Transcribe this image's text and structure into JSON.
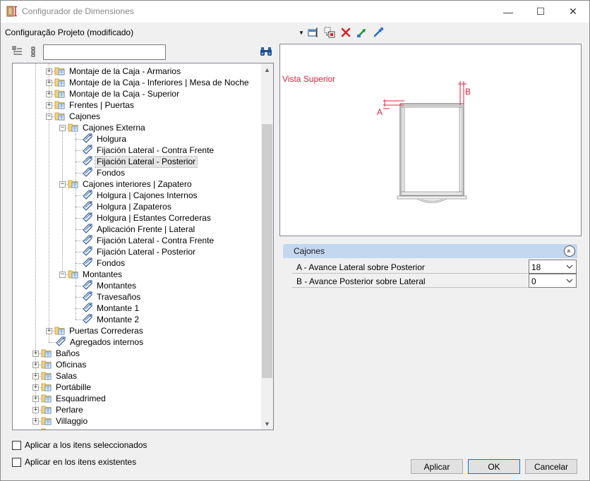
{
  "window": {
    "title": "Configurador de Dimensiones",
    "minimize_glyph": "—",
    "maximize_glyph": "☐",
    "close_glyph": "✕"
  },
  "config": {
    "label": "Configuração Projeto (modificado)",
    "dropdown_glyph": "▼"
  },
  "toolbar_icons": [
    "select-view-icon",
    "copy-config-icon",
    "delete-icon",
    "import-icon",
    "export-icon"
  ],
  "tree_search": {
    "value": "",
    "placeholder": ""
  },
  "tree": [
    {
      "label": "Montaje de la Caja - Armarios",
      "kind": "folder",
      "expander": "+"
    },
    {
      "label": "Montaje de la Caja - Inferiores | Mesa de Noche",
      "kind": "folder",
      "expander": "+"
    },
    {
      "label": "Montaje de la Caja - Superior",
      "kind": "folder",
      "expander": "+"
    },
    {
      "label": "Frentes | Puertas",
      "kind": "folder",
      "expander": "+"
    },
    {
      "label": "Cajones",
      "kind": "folder",
      "expander": "−"
    },
    {
      "label": "Cajones Externa",
      "kind": "folder",
      "expander": "−"
    },
    {
      "label": "Holgura",
      "kind": "leaf"
    },
    {
      "label": "Fijación Lateral - Contra Frente",
      "kind": "leaf"
    },
    {
      "label": "Fijación Lateral - Posterior",
      "kind": "leaf",
      "selected": true
    },
    {
      "label": "Fondos",
      "kind": "leaf"
    },
    {
      "label": "Cajones interiores | Zapatero",
      "kind": "folder",
      "expander": "−"
    },
    {
      "label": "Holgura | Cajones Internos",
      "kind": "leaf"
    },
    {
      "label": "Holgura | Zapateros",
      "kind": "leaf"
    },
    {
      "label": "Holgura | Estantes Correderas",
      "kind": "leaf"
    },
    {
      "label": "Aplicación Frente | Lateral",
      "kind": "leaf"
    },
    {
      "label": "Fijación Lateral - Contra Frente",
      "kind": "leaf"
    },
    {
      "label": "Fijación Lateral - Posterior",
      "kind": "leaf"
    },
    {
      "label": "Fondos",
      "kind": "leaf"
    },
    {
      "label": "Montantes",
      "kind": "folder",
      "expander": "−"
    },
    {
      "label": "Montantes",
      "kind": "leaf"
    },
    {
      "label": "Travesaños",
      "kind": "leaf"
    },
    {
      "label": "Montante 1",
      "kind": "leaf"
    },
    {
      "label": "Montante 2",
      "kind": "leaf"
    },
    {
      "label": "Puertas Correderas",
      "kind": "folder",
      "expander": "+"
    },
    {
      "label": "Agregados internos",
      "kind": "leaf"
    },
    {
      "label": "Baños",
      "kind": "folder",
      "expander": "+"
    },
    {
      "label": "Oficinas",
      "kind": "folder",
      "expander": "+"
    },
    {
      "label": "Salas",
      "kind": "folder",
      "expander": "+"
    },
    {
      "label": "Portábille",
      "kind": "folder",
      "expander": "+"
    },
    {
      "label": "Esquadrimed",
      "kind": "folder",
      "expander": "+"
    },
    {
      "label": "Perlare",
      "kind": "folder",
      "expander": "+"
    },
    {
      "label": "Villaggio",
      "kind": "folder",
      "expander": "+"
    },
    {
      "label": "",
      "kind": "folder",
      "expander": "+"
    }
  ],
  "scrollbar": {
    "up_glyph": "▲",
    "down_glyph": "▼"
  },
  "checkboxes": [
    {
      "label": "Aplicar a los itens seleccionados",
      "checked": false
    },
    {
      "label": "Aplicar en los itens existentes",
      "checked": false
    }
  ],
  "preview": {
    "view_label": "Vista Superior",
    "marker_a": "A",
    "marker_b": "B",
    "accent_color": "#e3223a"
  },
  "properties": {
    "group_label": "Cajones",
    "collapse_glyph": "«",
    "rows": [
      {
        "label": "A - Avance Lateral sobre Posterior",
        "value": "18"
      },
      {
        "label": "B - Avance Posterior sobre Lateral",
        "value": "0"
      }
    ]
  },
  "buttons": {
    "apply": "Aplicar",
    "ok": "OK",
    "cancel": "Cancelar"
  }
}
